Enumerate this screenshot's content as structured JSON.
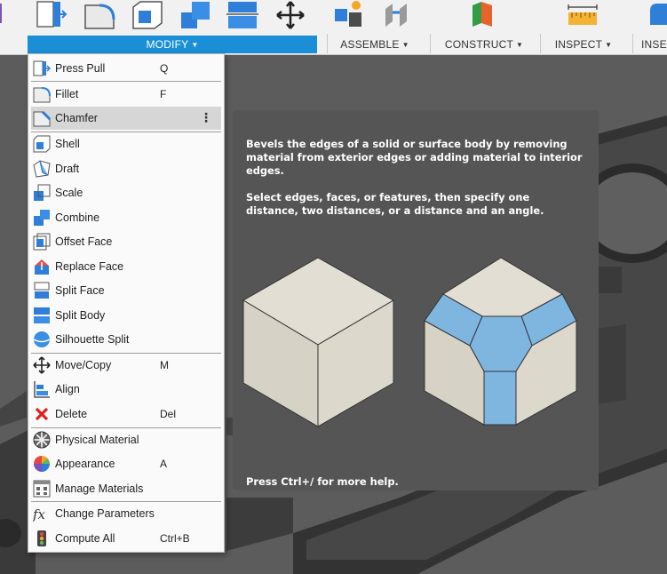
{
  "toolbar": {
    "groups": [
      {
        "label": "MODIFY",
        "active": true
      },
      {
        "label": "ASSEMBLE",
        "active": false
      },
      {
        "label": "CONSTRUCT",
        "active": false
      },
      {
        "label": "INSPECT",
        "active": false
      },
      {
        "label": "INSE",
        "active": false
      }
    ],
    "icons": [
      "press-pull-icon",
      "fillet-icon",
      "shell-icon",
      "combine-icon",
      "split-body-icon",
      "move-copy-icon",
      "assemble-new-component-icon",
      "joint-icon",
      "construct-plane-icon",
      "measure-icon",
      "insert-icon"
    ]
  },
  "menu": {
    "items": [
      {
        "label": "Press Pull",
        "shortcut": "Q",
        "icon": "press-pull-icon"
      },
      {
        "label": "Fillet",
        "shortcut": "F",
        "icon": "fillet-icon"
      },
      {
        "label": "Chamfer",
        "shortcut": "",
        "icon": "chamfer-icon",
        "highlighted": true
      },
      {
        "label": "Shell",
        "shortcut": "",
        "icon": "shell-icon"
      },
      {
        "label": "Draft",
        "shortcut": "",
        "icon": "draft-icon"
      },
      {
        "label": "Scale",
        "shortcut": "",
        "icon": "scale-icon"
      },
      {
        "label": "Combine",
        "shortcut": "",
        "icon": "combine-icon"
      },
      {
        "label": "Offset Face",
        "shortcut": "",
        "icon": "offset-face-icon"
      },
      {
        "label": "Replace Face",
        "shortcut": "",
        "icon": "replace-face-icon"
      },
      {
        "label": "Split Face",
        "shortcut": "",
        "icon": "split-face-icon"
      },
      {
        "label": "Split Body",
        "shortcut": "",
        "icon": "split-body-icon"
      },
      {
        "label": "Silhouette Split",
        "shortcut": "",
        "icon": "silhouette-split-icon"
      },
      {
        "label": "Move/Copy",
        "shortcut": "M",
        "icon": "move-copy-icon"
      },
      {
        "label": "Align",
        "shortcut": "",
        "icon": "align-icon"
      },
      {
        "label": "Delete",
        "shortcut": "Del",
        "icon": "delete-icon"
      },
      {
        "label": "Physical Material",
        "shortcut": "",
        "icon": "physical-material-icon"
      },
      {
        "label": "Appearance",
        "shortcut": "A",
        "icon": "appearance-icon"
      },
      {
        "label": "Manage Materials",
        "shortcut": "",
        "icon": "manage-materials-icon"
      },
      {
        "label": "Change Parameters",
        "shortcut": "",
        "icon": "change-parameters-icon"
      },
      {
        "label": "Compute All",
        "shortcut": "Ctrl+B",
        "icon": "compute-all-icon"
      }
    ],
    "more_icon": "more-options-icon"
  },
  "tooltip": {
    "description": "Bevels the edges of a solid or surface body by removing material from exterior edges or adding material to interior edges.",
    "instructions": "Select edges, faces, or features, then specify one distance, two distances, or a distance and an angle.",
    "help": "Press Ctrl+/ for more help."
  },
  "colors": {
    "accent": "#1a8fd8",
    "menu_highlight": "#d6d6d6",
    "tooltip_bg": "#555555",
    "cube_face": "#e2ddd2",
    "chamfer_face": "#7fb6e0"
  }
}
